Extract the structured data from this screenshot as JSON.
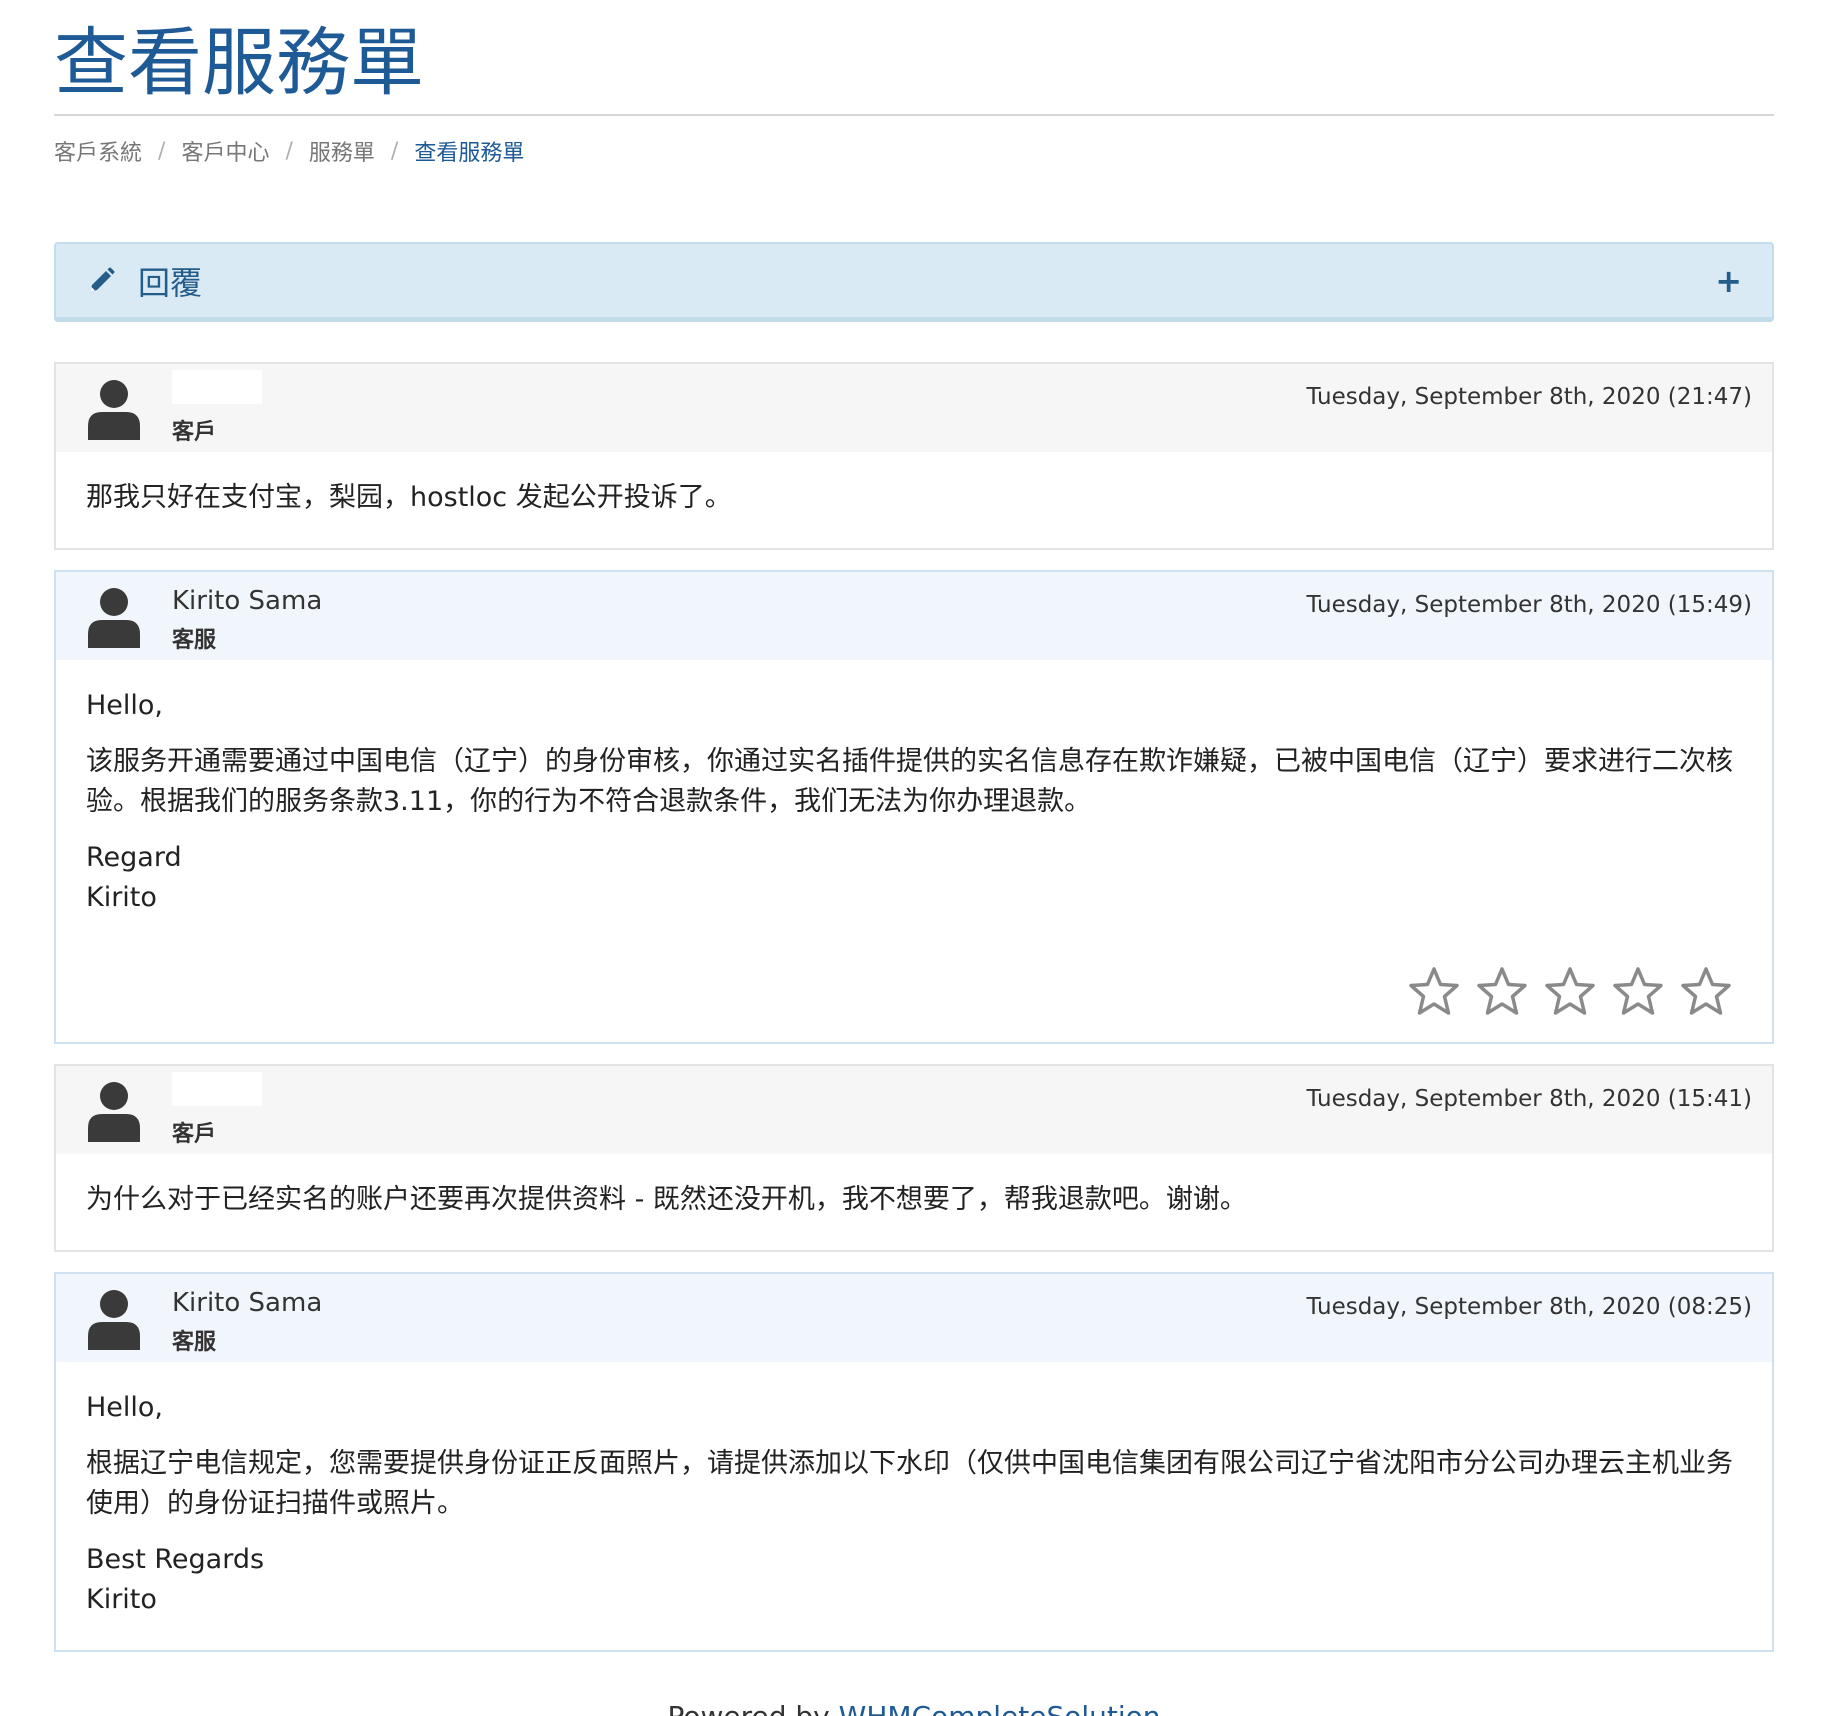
{
  "page": {
    "title": "查看服務單"
  },
  "breadcrumb": {
    "items": [
      "客戶系統",
      "客戶中心",
      "服務單"
    ],
    "active": "查看服務單",
    "separator": "/"
  },
  "reply_panel": {
    "label": "回覆",
    "icon": "pencil-icon",
    "toggle_icon": "plus-icon"
  },
  "messages": [
    {
      "name": "",
      "role": "客戶",
      "date": "Tuesday, September 8th, 2020 (21:47)",
      "paragraphs": [
        "那我只好在支付宝，梨园，hostloc 发起公开投诉了。"
      ]
    },
    {
      "name": "Kirito Sama",
      "role": "客服",
      "date": "Tuesday, September 8th, 2020 (15:49)",
      "paragraphs": [
        "Hello,",
        "该服务开通需要通过中国电信（辽宁）的身份审核，你通过实名插件提供的实名信息存在欺诈嫌疑，已被中国电信（辽宁）要求进行二次核验。根据我们的服务条款3.11，你的行为不符合退款条件，我们无法为你办理退款。",
        "Regard",
        "Kirito"
      ],
      "rating": {
        "value": 0,
        "max": 5
      }
    },
    {
      "name": "",
      "role": "客戶",
      "date": "Tuesday, September 8th, 2020 (15:41)",
      "paragraphs": [
        "为什么对于已经实名的账户还要再次提供资料 - 既然还没开机，我不想要了，帮我退款吧。谢谢。"
      ]
    },
    {
      "name": "Kirito Sama",
      "role": "客服",
      "date": "Tuesday, September 8th, 2020 (08:25)",
      "paragraphs": [
        "Hello,",
        "根据辽宁电信规定，您需要提供身份证正反面照片，请提供添加以下水印（仅供中国电信集团有限公司辽宁省沈阳市分公司办理云主机业务使用）的身份证扫描件或照片。",
        "Best Regards",
        "Kirito"
      ]
    }
  ],
  "footer": {
    "prefix": "Powered by ",
    "link_text": "WHMCompleteSolution"
  },
  "colors": {
    "title": "#1e5a96",
    "reply_bg": "#daeaf5",
    "client_header_bg": "#f6f6f6",
    "staff_header_bg": "#f1f6fc",
    "staff_border": "#cfe0f1"
  }
}
